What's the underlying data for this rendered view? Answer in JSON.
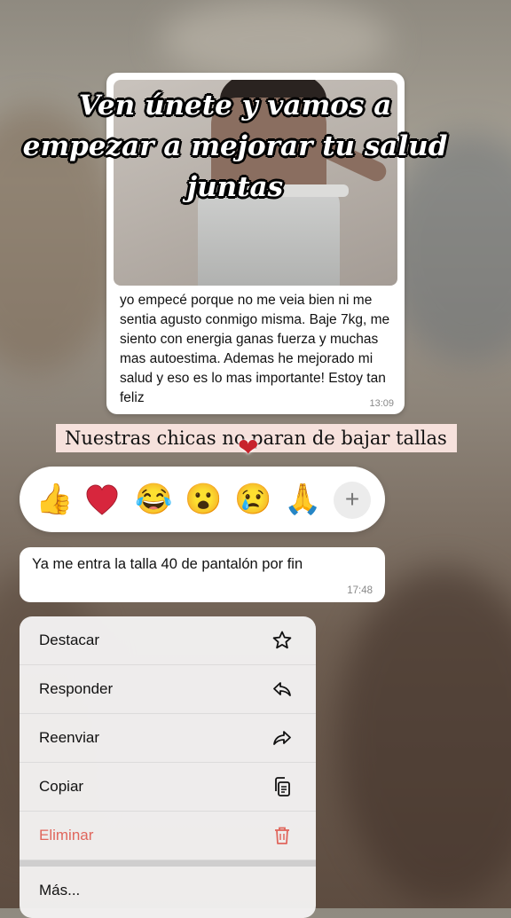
{
  "overlay": {
    "title": "Ven únete y vamos a empezar a mejorar tu salud juntas",
    "banner": "Nuestras chicas no paran de bajar tallas"
  },
  "testimonial_card": {
    "text": "yo empecé porque no me veia bien ni me sentia agusto conmigo misma. Baje 7kg, me siento con energia ganas fuerza y muchas mas autoestima. Ademas he mejorado mi salud y eso es lo mas importante! Estoy tan feliz",
    "time": "13:09"
  },
  "reactions": {
    "items": [
      {
        "name": "thumbs-up",
        "glyph": "👍"
      },
      {
        "name": "heart",
        "glyph": "❤"
      },
      {
        "name": "laughing",
        "glyph": "😂"
      },
      {
        "name": "surprised",
        "glyph": "😮"
      },
      {
        "name": "crying",
        "glyph": "😢"
      },
      {
        "name": "praying-hands",
        "glyph": "🙏"
      }
    ],
    "more": "+"
  },
  "message": {
    "text": "Ya me entra la talla 40 de pantalón por fin",
    "time": "17:48"
  },
  "context_menu": {
    "items": [
      {
        "label": "Destacar",
        "icon": "star-icon"
      },
      {
        "label": "Responder",
        "icon": "reply-icon"
      },
      {
        "label": "Reenviar",
        "icon": "forward-icon"
      },
      {
        "label": "Copiar",
        "icon": "copy-icon"
      },
      {
        "label": "Eliminar",
        "icon": "trash-icon"
      },
      {
        "label": "Más...",
        "icon": ""
      }
    ]
  },
  "colors": {
    "delete": "#e0665c",
    "banner_bg": "#f6e1dc"
  }
}
